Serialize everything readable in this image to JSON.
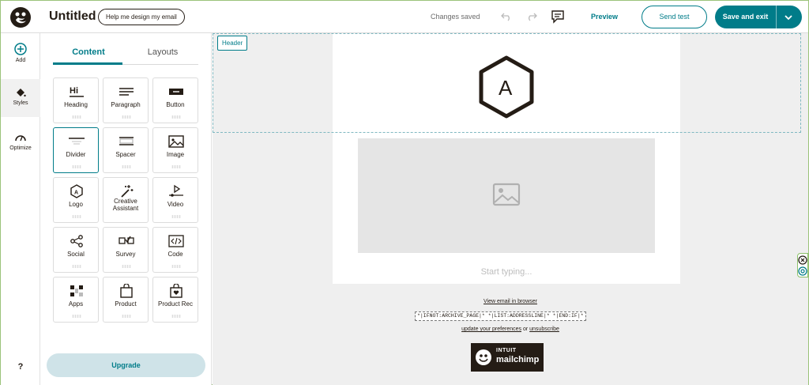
{
  "topbar": {
    "title": "Untitled",
    "help_button": "Help me design my email",
    "status": "Changes saved",
    "preview": "Preview",
    "send_test": "Send test",
    "save_exit": "Save and exit"
  },
  "rail": {
    "add": "Add",
    "styles": "Styles",
    "optimize": "Optimize",
    "help": "?"
  },
  "panel": {
    "tabs": [
      "Content",
      "Layouts"
    ],
    "blocks": [
      {
        "label": "Heading"
      },
      {
        "label": "Paragraph"
      },
      {
        "label": "Button"
      },
      {
        "label": "Divider"
      },
      {
        "label": "Spacer"
      },
      {
        "label": "Image"
      },
      {
        "label": "Logo"
      },
      {
        "label": "Creative Assistant"
      },
      {
        "label": "Video"
      },
      {
        "label": "Social"
      },
      {
        "label": "Survey"
      },
      {
        "label": "Code"
      },
      {
        "label": "Apps"
      },
      {
        "label": "Product"
      },
      {
        "label": "Product Rec"
      }
    ],
    "heading_icon_text": "Hi",
    "logo_icon_text": "A",
    "upgrade": "Upgrade"
  },
  "canvas": {
    "header_tag": "Header",
    "logo_letter": "A",
    "placeholder": "Start typing...",
    "view_in_browser": "View email in browser",
    "merge_tags": "*|IFNOT:ARCHIVE_PAGE|* *|LIST:ADDRESSLINE|* *|END:IF|*",
    "update_text": "update your preferences",
    "or_text": "or",
    "unsubscribe": "unsubscribe",
    "badge_brand": "INTUIT",
    "badge_name": "mailchimp"
  },
  "colors": {
    "accent": "#007c89",
    "dark": "#241c15",
    "canvas_bg": "#efefef"
  }
}
